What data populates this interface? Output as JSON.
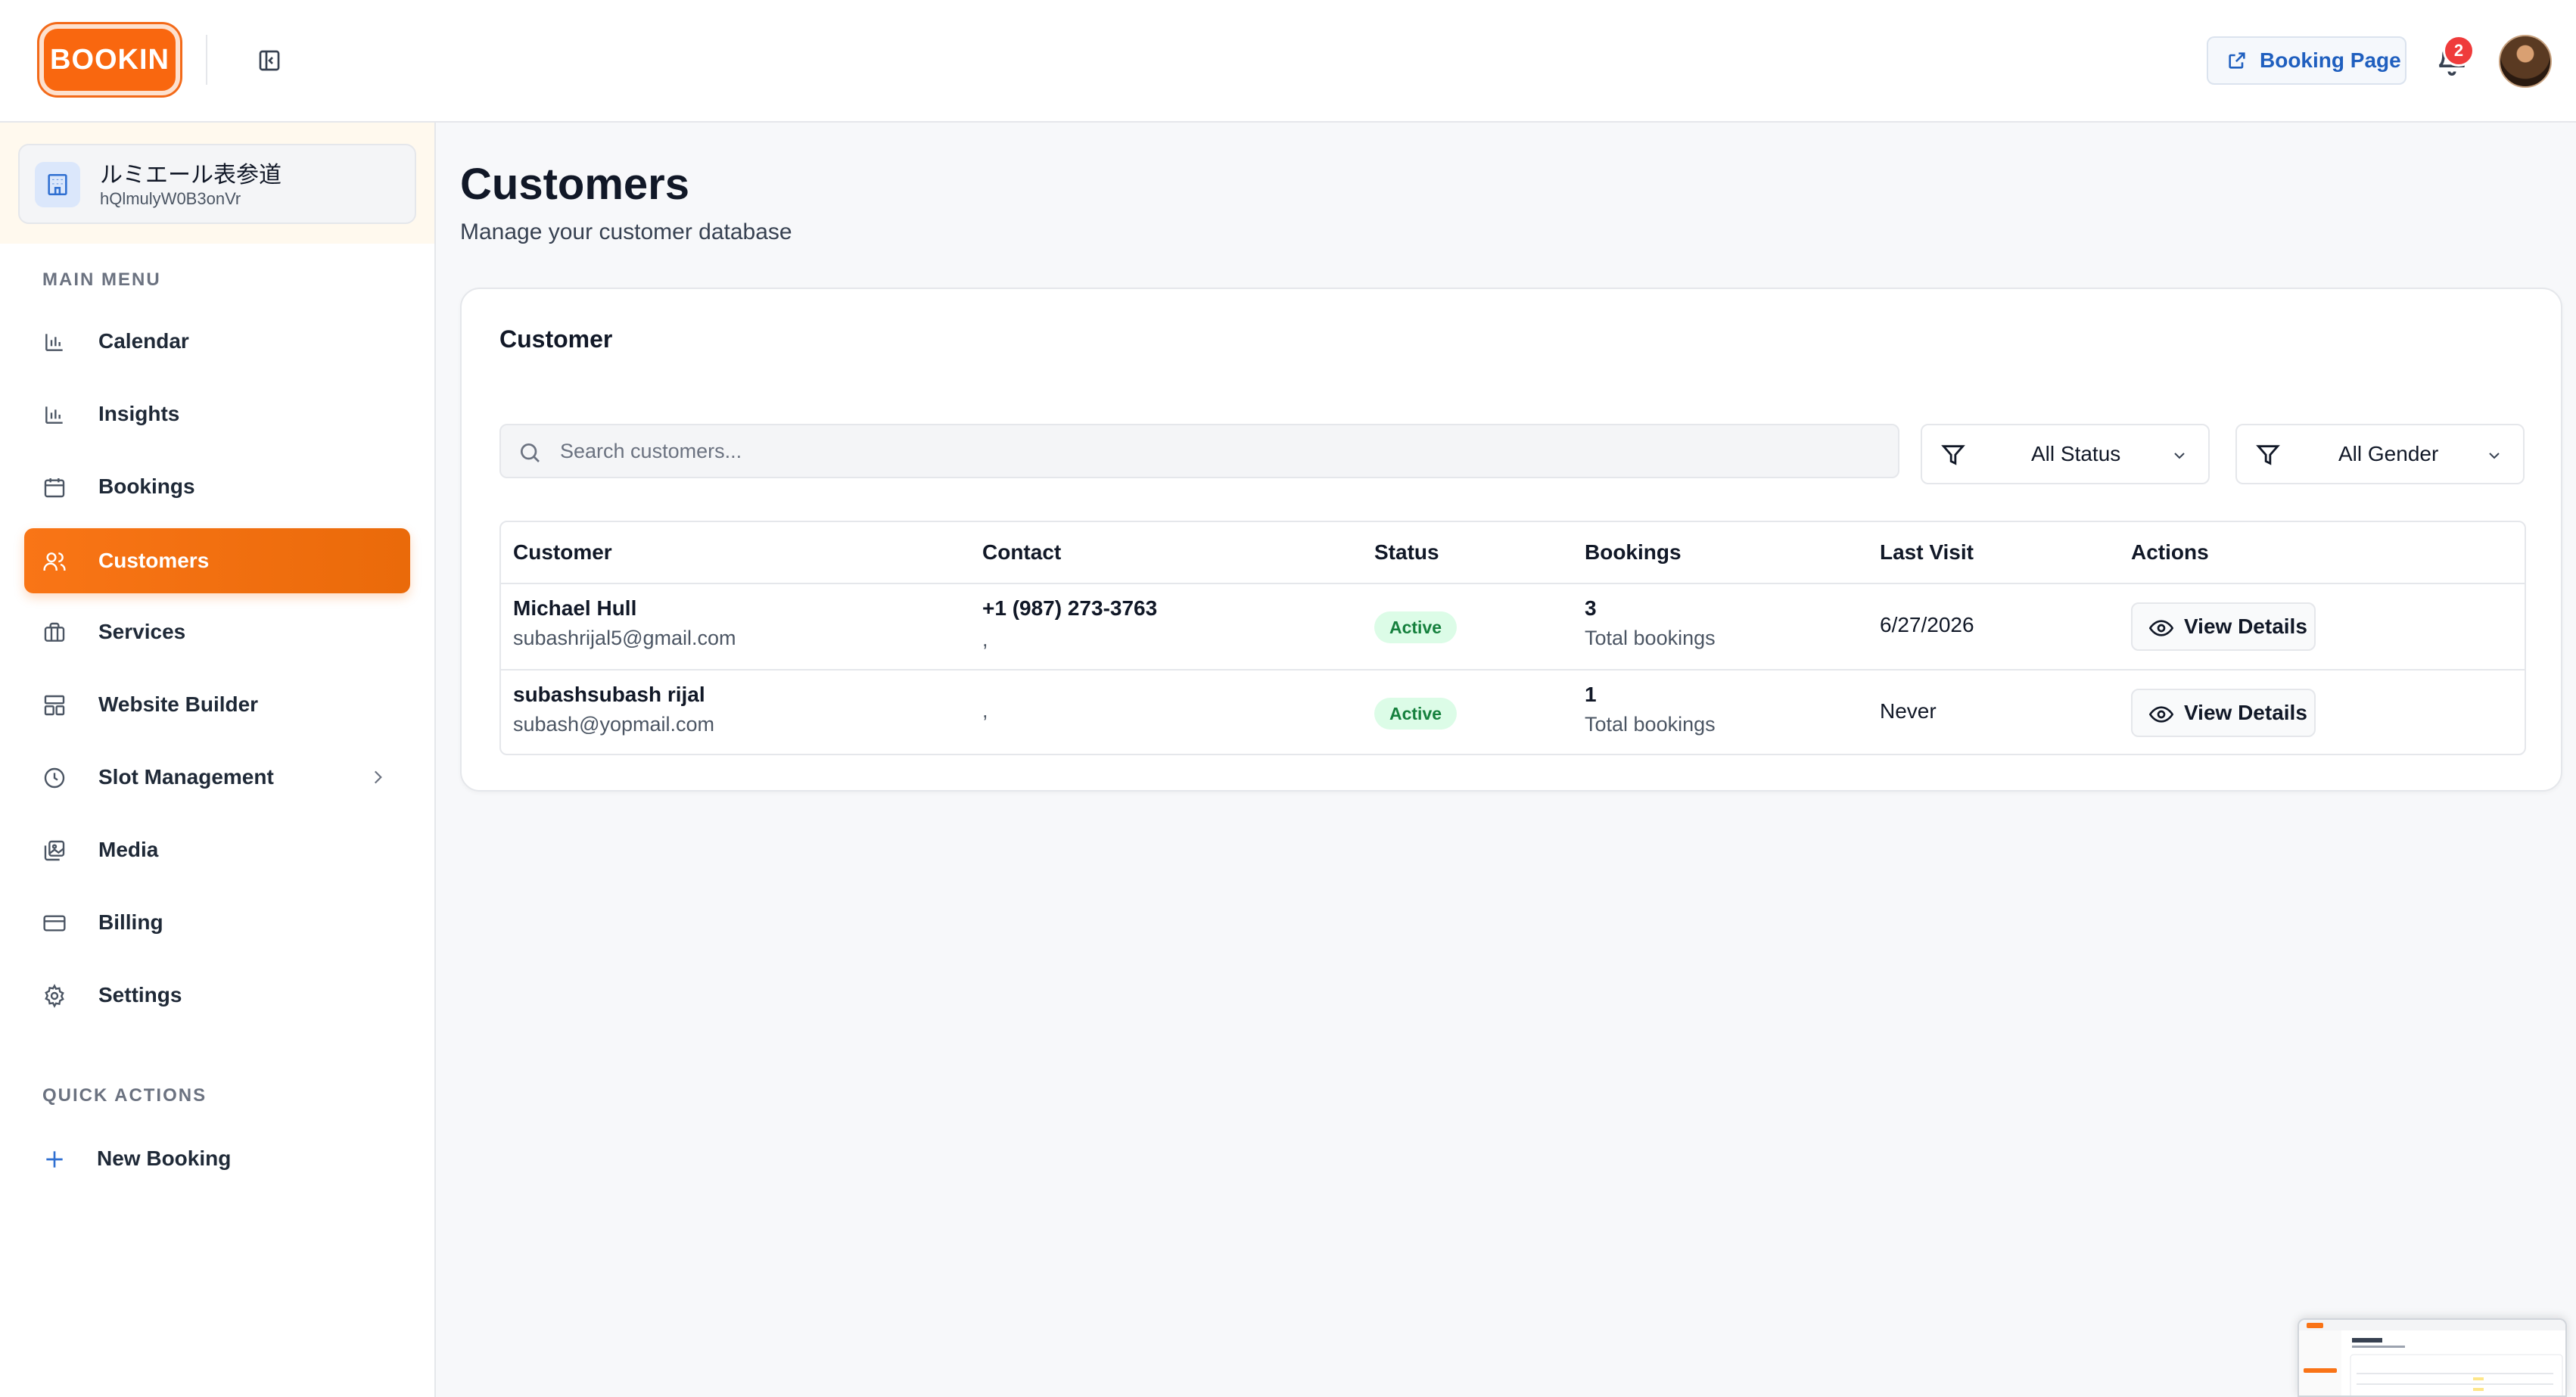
{
  "header": {
    "logo_text": "BOOKIN",
    "booking_page_label": "Booking Page",
    "notification_count": "2"
  },
  "workspace": {
    "name": "ルミエール表参道",
    "id": "hQlmulyW0B3onVr"
  },
  "sidebar": {
    "main_menu_label": "MAIN MENU",
    "items": [
      {
        "label": "Calendar",
        "icon": "bar-chart-icon"
      },
      {
        "label": "Insights",
        "icon": "bar-chart-icon"
      },
      {
        "label": "Bookings",
        "icon": "calendar-icon"
      },
      {
        "label": "Customers",
        "icon": "users-icon",
        "active": true
      },
      {
        "label": "Services",
        "icon": "briefcase-icon"
      },
      {
        "label": "Website Builder",
        "icon": "layout-icon"
      },
      {
        "label": "Slot Management",
        "icon": "clock-icon",
        "has_submenu": true
      },
      {
        "label": "Media",
        "icon": "images-icon"
      },
      {
        "label": "Billing",
        "icon": "credit-card-icon"
      },
      {
        "label": "Settings",
        "icon": "gear-icon"
      }
    ],
    "quick_actions_label": "QUICK ACTIONS",
    "quick_actions": [
      {
        "label": "New Booking",
        "icon": "plus-icon"
      }
    ]
  },
  "page": {
    "title": "Customers",
    "subtitle": "Manage your customer database"
  },
  "card": {
    "title": "Customer",
    "search_placeholder": "Search customers...",
    "status_filter": "All Status",
    "gender_filter": "All Gender"
  },
  "table": {
    "headers": [
      "Customer",
      "Contact",
      "Status",
      "Bookings",
      "Last Visit",
      "Actions"
    ],
    "rows": [
      {
        "name": "Michael Hull",
        "email": "subashrijal5@gmail.com",
        "phone": "+1 (987) 273-3763",
        "contact_extra": ",",
        "status": "Active",
        "bookings": "3",
        "bookings_label": "Total bookings",
        "last_visit": "6/27/2026",
        "action": "View Details"
      },
      {
        "name": "subashsubash rijal",
        "email": "subash@yopmail.com",
        "phone": "",
        "contact_extra": ",",
        "status": "Active",
        "bookings": "1",
        "bookings_label": "Total bookings",
        "last_visit": "Never",
        "action": "View Details"
      }
    ]
  },
  "colors": {
    "brand": "#f97316",
    "link": "#1f5fbf",
    "active_badge_bg": "#dcfce7",
    "active_badge_text": "#15803d",
    "notification": "#ef3b3b"
  }
}
